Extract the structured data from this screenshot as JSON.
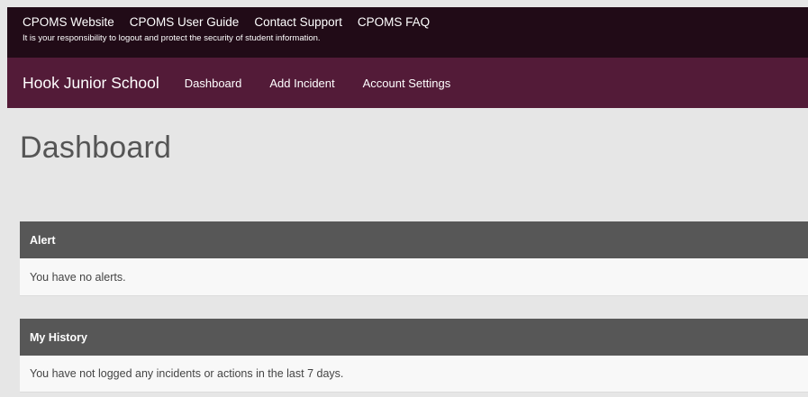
{
  "topbar": {
    "links": [
      "CPOMS Website",
      "CPOMS User Guide",
      "Contact Support",
      "CPOMS FAQ"
    ],
    "notice": "It is your responsibility to logout and protect the security of student information."
  },
  "navbar": {
    "brand": "Hook Junior School",
    "links": [
      "Dashboard",
      "Add Incident",
      "Account Settings"
    ]
  },
  "main": {
    "title": "Dashboard",
    "panels": [
      {
        "heading": "Alert",
        "message": "You have no alerts."
      },
      {
        "heading": "My History",
        "message": "You have not logged any incidents or actions in the last 7 days."
      }
    ]
  },
  "colors": {
    "topbar_bg": "#210b17",
    "navbar_bg": "#531b38",
    "panel_header_bg": "#575757",
    "page_bg": "#e6e6e6"
  }
}
